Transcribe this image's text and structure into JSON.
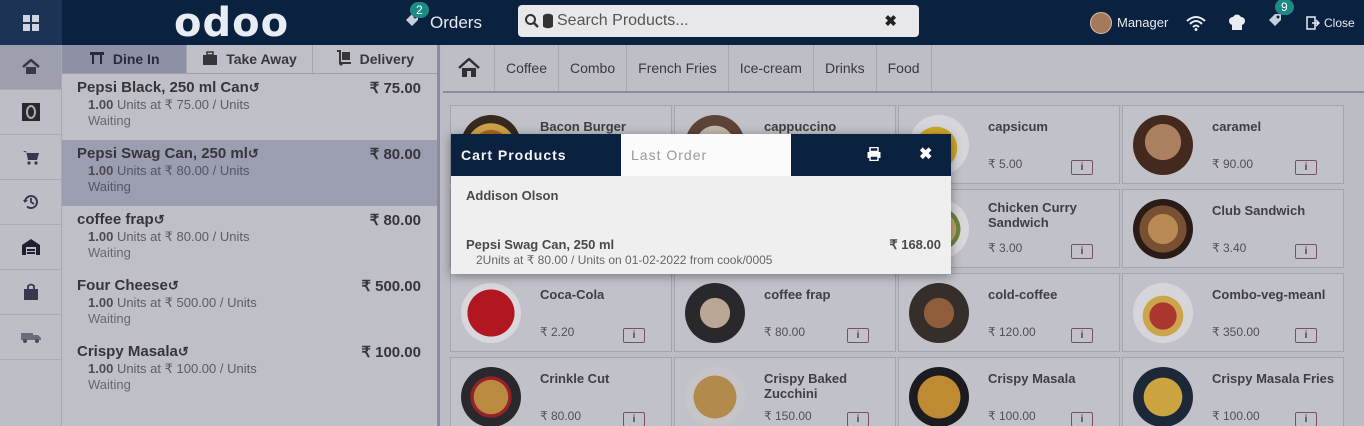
{
  "header": {
    "logo": "odoo",
    "orders_label": "Orders",
    "orders_badge": "2",
    "search_placeholder": "Search Products...",
    "manager_label": "Manager",
    "sync_badge": "9",
    "close_label": "Close"
  },
  "order_tabs": [
    {
      "label": "Dine In",
      "active": true
    },
    {
      "label": "Take Away",
      "active": false
    },
    {
      "label": "Delivery",
      "active": false
    }
  ],
  "orderlines": [
    {
      "name": "Pepsi Black, 250 ml Can",
      "price": "₹ 75.00",
      "qty": "1.00",
      "unit_text": "Units at ₹ 75.00 / Units",
      "status": "Waiting",
      "selected": false
    },
    {
      "name": "Pepsi Swag Can, 250 ml",
      "price": "₹ 80.00",
      "qty": "1.00",
      "unit_text": "Units at ₹ 80.00 / Units",
      "status": "Waiting",
      "selected": true
    },
    {
      "name": "coffee frap",
      "price": "₹ 80.00",
      "qty": "1.00",
      "unit_text": "Units at ₹ 80.00 / Units",
      "status": "Waiting",
      "selected": false
    },
    {
      "name": "Four Cheese",
      "price": "₹ 500.00",
      "qty": "1.00",
      "unit_text": "Units at ₹ 500.00 / Units",
      "status": "Waiting",
      "selected": false
    },
    {
      "name": "Crispy Masala",
      "price": "₹ 100.00",
      "qty": "1.00",
      "unit_text": "Units at ₹ 100.00 / Units",
      "status": "Waiting",
      "selected": false
    }
  ],
  "categories": [
    "Coffee",
    "Combo",
    "French Fries",
    "Ice-cream",
    "Drinks",
    "Food"
  ],
  "products": [
    {
      "name": "Bacon Burger",
      "price": "",
      "col": 0,
      "row": 0
    },
    {
      "name": "cappuccino",
      "price": "",
      "col": 1,
      "row": 0
    },
    {
      "name": "capsicum",
      "price": "₹ 5.00",
      "col": 2,
      "row": 0
    },
    {
      "name": "caramel",
      "price": "₹ 90.00",
      "col": 3,
      "row": 0
    },
    {
      "name": "",
      "price": "",
      "col": 0,
      "row": 1
    },
    {
      "name": "",
      "price": "",
      "col": 1,
      "row": 1
    },
    {
      "name": "Chicken Curry Sandwich",
      "price": "₹ 3.00",
      "col": 2,
      "row": 1
    },
    {
      "name": "Club Sandwich",
      "price": "₹ 3.40",
      "col": 3,
      "row": 1
    },
    {
      "name": "Coca-Cola",
      "price": "₹ 2.20",
      "col": 0,
      "row": 2
    },
    {
      "name": "coffee frap",
      "price": "₹ 80.00",
      "col": 1,
      "row": 2
    },
    {
      "name": "cold-coffee",
      "price": "₹ 120.00",
      "col": 2,
      "row": 2
    },
    {
      "name": "Combo-veg-meanl",
      "price": "₹ 350.00",
      "col": 3,
      "row": 2
    },
    {
      "name": "Crinkle Cut",
      "price": "₹ 80.00",
      "col": 0,
      "row": 3
    },
    {
      "name": "Crispy Baked Zucchini",
      "price": "₹ 150.00",
      "col": 1,
      "row": 3
    },
    {
      "name": "Crispy Masala",
      "price": "₹ 100.00",
      "col": 2,
      "row": 3
    },
    {
      "name": "Crispy Masala Fries",
      "price": "₹ 100.00",
      "col": 3,
      "row": 3
    }
  ],
  "popup": {
    "title": "Cart Products",
    "tab_last_order": "Last Order",
    "customer": "Addison Olson",
    "line_name": "Pepsi Swag Can, 250 ml",
    "line_price": "₹ 168.00",
    "line_detail": "2Units at ₹ 80.00 / Units on 01-02-2022 from cook/0005"
  },
  "colors": {
    "navbar": "#0b2140",
    "selected_line": "#b5b7cb",
    "badge": "#1e8a86"
  }
}
